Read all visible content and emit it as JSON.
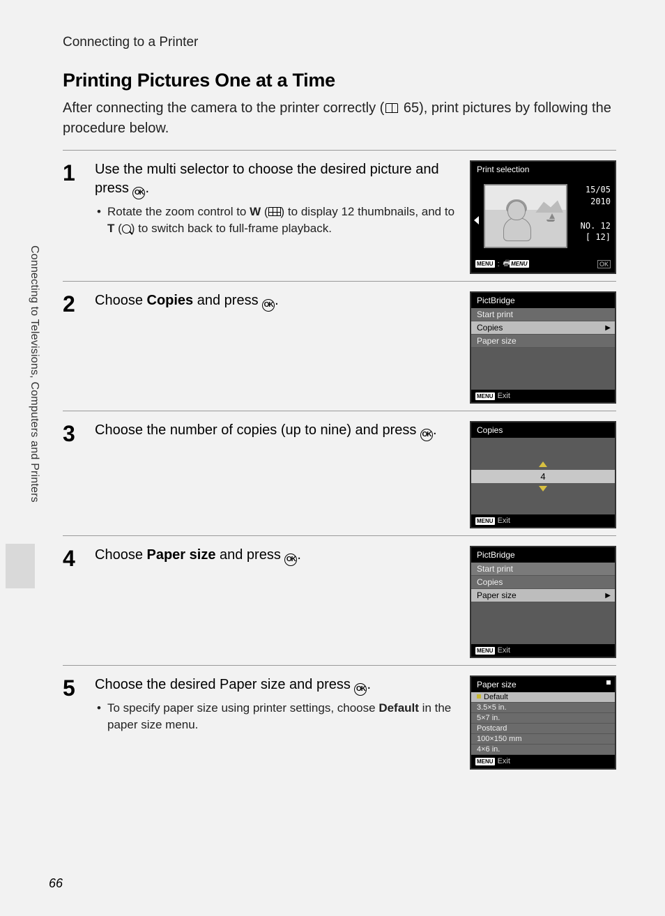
{
  "page_number": "66",
  "header_sub": "Connecting to a Printer",
  "side_label": "Connecting to Televisions, Computers and Printers",
  "title": "Printing Pictures One at a Time",
  "intro_pre": "After connecting the camera to the printer correctly (",
  "intro_ref": " 65), print pictures by following the procedure below.",
  "steps": {
    "s1": {
      "num": "1",
      "main_a": "Use the multi selector to choose the desired picture and press ",
      "main_b": ".",
      "bul_a": "Rotate the zoom control to ",
      "bul_w": "W",
      "bul_b": " (",
      "bul_c": ") to display 12 thumbnails, and to ",
      "bul_t": "T",
      "bul_d": " (",
      "bul_e": ") to switch back to full-frame playback."
    },
    "s2": {
      "num": "2",
      "main_a": "Choose ",
      "bold": "Copies",
      "main_b": " and press ",
      "main_c": "."
    },
    "s3": {
      "num": "3",
      "main_a": "Choose the number of copies (up to nine) and press ",
      "main_b": "."
    },
    "s4": {
      "num": "4",
      "main_a": "Choose ",
      "bold": "Paper size",
      "main_b": " and press ",
      "main_c": "."
    },
    "s5": {
      "num": "5",
      "main_a": "Choose the desired Paper size and press ",
      "main_b": ".",
      "bul_a": "To specify paper size using printer settings, choose ",
      "bold": "Default",
      "bul_b": " in the paper size menu."
    }
  },
  "screens": {
    "print_selection": {
      "title": "Print selection",
      "date": "15/05",
      "year": "2010",
      "no": "NO.  12",
      "count": "[  12]",
      "foot_menu": "MENU"
    },
    "pictbridge1": {
      "title": "PictBridge",
      "items": [
        "Start print",
        "Copies",
        "Paper size"
      ],
      "selected_index": 1,
      "foot": "Exit"
    },
    "copies": {
      "title": "Copies",
      "value": "4",
      "foot": "Exit"
    },
    "pictbridge2": {
      "title": "PictBridge",
      "items": [
        "Start print",
        "Copies",
        "Paper size"
      ],
      "selected_index": 2,
      "foot": "Exit"
    },
    "paper_size": {
      "title": "Paper size",
      "items": [
        "Default",
        "3.5×5 in.",
        "5×7 in.",
        "Postcard",
        "100×150 mm",
        "4×6 in."
      ],
      "selected_index": 0,
      "foot": "Exit"
    }
  }
}
